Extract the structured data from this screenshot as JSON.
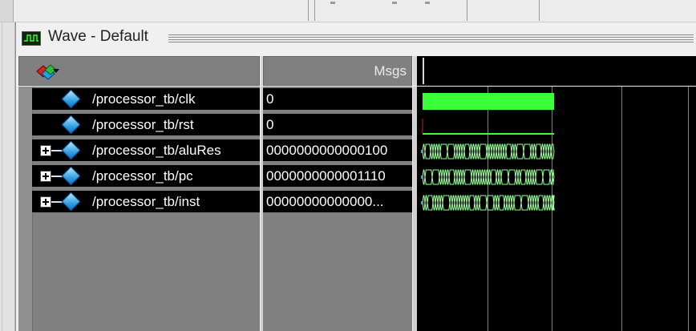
{
  "window": {
    "title": "Wave - Default"
  },
  "header": {
    "msgs_label": "Msgs"
  },
  "signals": [
    {
      "name": "/processor_tb/clk",
      "value": "0",
      "expandable": false,
      "kind": "clock"
    },
    {
      "name": "/processor_tb/rst",
      "value": "0",
      "expandable": false,
      "kind": "low"
    },
    {
      "name": "/processor_tb/aluRes",
      "value": "0000000000000100",
      "expandable": true,
      "kind": "bus"
    },
    {
      "name": "/processor_tb/pc",
      "value": "0000000000001110",
      "expandable": true,
      "kind": "bus"
    },
    {
      "name": "/processor_tb/inst",
      "value": "00000000000000...",
      "expandable": true,
      "kind": "bus"
    }
  ],
  "colors": {
    "waveform": "#38ff38",
    "bus": "#9cff9c",
    "signal_icon": "#3aa6e8",
    "background": "#000000"
  },
  "icons": {
    "window": "wave-window-icon",
    "toolbar": "add-signal-icon",
    "signal": "signal-diamond-icon",
    "expand": "expand-plus-icon"
  }
}
